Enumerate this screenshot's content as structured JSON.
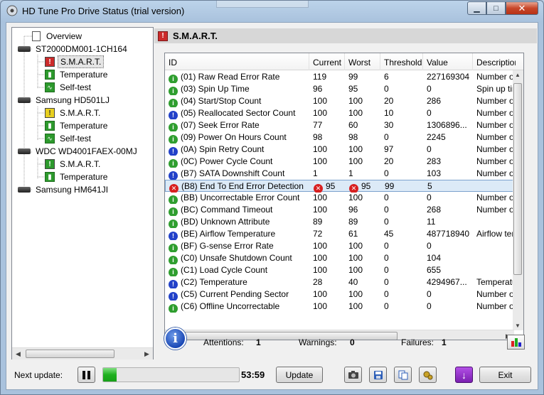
{
  "window": {
    "title": "HD Tune Pro Drive Status (trial version)",
    "controls": {
      "minimize": "▁",
      "maximize": "□",
      "close": "✕"
    }
  },
  "tree": {
    "items": [
      {
        "label": "Overview",
        "kind": "overview",
        "icon": "document-icon"
      },
      {
        "label": "ST2000DM001-1CH164",
        "kind": "drive",
        "icon": "hard-drive-icon"
      },
      {
        "label": "S.M.A.R.T.",
        "kind": "smart-red",
        "icon": "smart-icon",
        "selected": true
      },
      {
        "label": "Temperature",
        "kind": "temp",
        "icon": "thermometer-icon"
      },
      {
        "label": "Self-test",
        "kind": "selftest",
        "icon": "pulse-icon"
      },
      {
        "label": "Samsung HD501LJ",
        "kind": "drive",
        "icon": "hard-drive-icon"
      },
      {
        "label": "S.M.A.R.T.",
        "kind": "smart-yellow",
        "icon": "smart-icon"
      },
      {
        "label": "Temperature",
        "kind": "temp",
        "icon": "thermometer-icon"
      },
      {
        "label": "Self-test",
        "kind": "selftest",
        "icon": "pulse-icon"
      },
      {
        "label": "WDC     WD4001FAEX-00MJ",
        "kind": "drive",
        "icon": "hard-drive-icon"
      },
      {
        "label": "S.M.A.R.T.",
        "kind": "smart-green",
        "icon": "smart-icon"
      },
      {
        "label": "Temperature",
        "kind": "temp",
        "icon": "thermometer-icon"
      },
      {
        "label": "Samsung HM641JI",
        "kind": "drive",
        "icon": "hard-drive-icon"
      }
    ]
  },
  "panel": {
    "title": "S.M.A.R.T."
  },
  "table": {
    "columns": [
      "ID",
      "Current",
      "Worst",
      "Threshold",
      "Value",
      "Description"
    ],
    "rows": [
      {
        "status": "ok",
        "id": "(01) Raw Read Error Rate",
        "current": "119",
        "worst": "99",
        "threshold": "6",
        "value": "227169304",
        "desc": "Number of"
      },
      {
        "status": "ok",
        "id": "(03) Spin Up Time",
        "current": "96",
        "worst": "95",
        "threshold": "0",
        "value": "0",
        "desc": "Spin up tim"
      },
      {
        "status": "ok",
        "id": "(04) Start/Stop Count",
        "current": "100",
        "worst": "100",
        "threshold": "20",
        "value": "286",
        "desc": "Number of"
      },
      {
        "status": "warn",
        "id": "(05) Reallocated Sector Count",
        "current": "100",
        "worst": "100",
        "threshold": "10",
        "value": "0",
        "desc": "Number of"
      },
      {
        "status": "ok",
        "id": "(07) Seek Error Rate",
        "current": "77",
        "worst": "60",
        "threshold": "30",
        "value": "1306896...",
        "desc": "Number of"
      },
      {
        "status": "ok",
        "id": "(09) Power On Hours Count",
        "current": "98",
        "worst": "98",
        "threshold": "0",
        "value": "2245",
        "desc": "Number of"
      },
      {
        "status": "warn",
        "id": "(0A) Spin Retry Count",
        "current": "100",
        "worst": "100",
        "threshold": "97",
        "value": "0",
        "desc": "Number of"
      },
      {
        "status": "ok",
        "id": "(0C) Power Cycle Count",
        "current": "100",
        "worst": "100",
        "threshold": "20",
        "value": "283",
        "desc": "Number of"
      },
      {
        "status": "warn",
        "id": "(B7) SATA Downshift Count",
        "current": "1",
        "worst": "1",
        "threshold": "0",
        "value": "103",
        "desc": "Number of"
      },
      {
        "status": "err",
        "id": "(B8) End To End Error Detection",
        "current": "95",
        "worst": "95",
        "threshold": "99",
        "value": "5",
        "desc": "",
        "current_err": true,
        "worst_err": true
      },
      {
        "status": "ok",
        "id": "(BB) Uncorrectable Error Count",
        "current": "100",
        "worst": "100",
        "threshold": "0",
        "value": "0",
        "desc": "Number of"
      },
      {
        "status": "ok",
        "id": "(BC) Command Timeout",
        "current": "100",
        "worst": "96",
        "threshold": "0",
        "value": "268",
        "desc": "Number of"
      },
      {
        "status": "ok",
        "id": "(BD) Unknown Attribute",
        "current": "89",
        "worst": "89",
        "threshold": "0",
        "value": "11",
        "desc": ""
      },
      {
        "status": "warn",
        "id": "(BE) Airflow Temperature",
        "current": "72",
        "worst": "61",
        "threshold": "45",
        "value": "487718940",
        "desc": "Airflow temp"
      },
      {
        "status": "ok",
        "id": "(BF) G-sense Error Rate",
        "current": "100",
        "worst": "100",
        "threshold": "0",
        "value": "0",
        "desc": ""
      },
      {
        "status": "ok",
        "id": "(C0) Unsafe Shutdown Count",
        "current": "100",
        "worst": "100",
        "threshold": "0",
        "value": "104",
        "desc": ""
      },
      {
        "status": "ok",
        "id": "(C1) Load Cycle Count",
        "current": "100",
        "worst": "100",
        "threshold": "0",
        "value": "655",
        "desc": ""
      },
      {
        "status": "warn",
        "id": "(C2) Temperature",
        "current": "28",
        "worst": "40",
        "threshold": "0",
        "value": "4294967...",
        "desc": "Temperatur"
      },
      {
        "status": "warn",
        "id": "(C5) Current Pending Sector",
        "current": "100",
        "worst": "100",
        "threshold": "0",
        "value": "0",
        "desc": "Number of"
      },
      {
        "status": "ok",
        "id": "(C6) Offline Uncorrectable",
        "current": "100",
        "worst": "100",
        "threshold": "0",
        "value": "0",
        "desc": "Number of"
      }
    ]
  },
  "summary": {
    "attentions_label": "Attentions:",
    "attentions": "1",
    "warnings_label": "Warnings:",
    "warnings": "0",
    "failures_label": "Failures:",
    "failures": "1"
  },
  "bottom": {
    "next_update_label": "Next update:",
    "pause_icon": "pause-icon",
    "progress": 0.1,
    "countdown": "53:59",
    "update_label": "Update",
    "exit_label": "Exit"
  },
  "colors": {
    "ok": "#2f9e2f",
    "warn": "#2241c9",
    "err": "#d82020",
    "selection": "#dceaf7",
    "progress": "#1fb01f",
    "accent_purple": "#8c26c9"
  }
}
